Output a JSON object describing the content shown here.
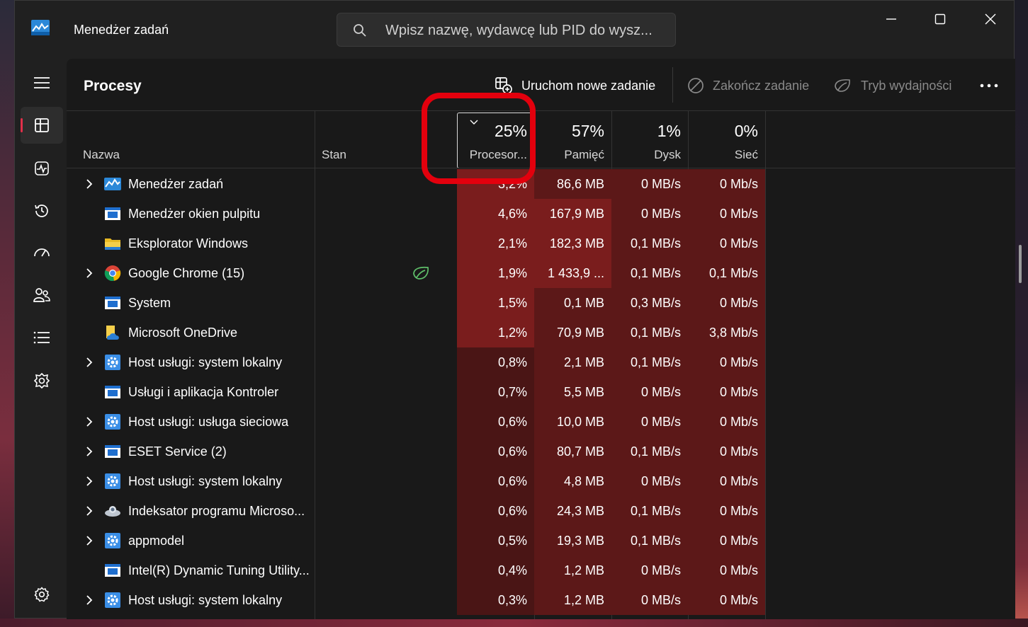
{
  "window": {
    "title": "Menedżer zadań",
    "search_placeholder": "Wpisz nazwę, wydawcę lub PID do wysz..."
  },
  "nav": {
    "items": [
      {
        "icon": "processes-icon",
        "active": true
      },
      {
        "icon": "performance-icon",
        "active": false
      },
      {
        "icon": "app-history-icon",
        "active": false
      },
      {
        "icon": "startup-apps-icon",
        "active": false
      },
      {
        "icon": "users-icon",
        "active": false
      },
      {
        "icon": "details-icon",
        "active": false
      },
      {
        "icon": "services-icon",
        "active": false
      }
    ],
    "settings_icon": "gear-icon"
  },
  "page": {
    "title": "Procesy",
    "commands": {
      "new_task": "Uruchom nowe zadanie",
      "end_task": "Zakończ zadanie",
      "efficiency_mode": "Tryb wydajności"
    }
  },
  "columns": {
    "name": "Nazwa",
    "status": "Stan",
    "cpu": {
      "pct": "25%",
      "label": "Procesor..."
    },
    "memory": {
      "pct": "57%",
      "label": "Pamięć"
    },
    "disk": {
      "pct": "1%",
      "label": "Dysk"
    },
    "network": {
      "pct": "0%",
      "label": "Sieć"
    }
  },
  "colors": {
    "accent": "#e0304a",
    "heat_high": "#7a1d1d",
    "heat_mid": "#5c1818",
    "heat_low": "#4a1515",
    "highlight": "#e3000d"
  },
  "processes": [
    {
      "name": "Menedżer zadań",
      "expandable": true,
      "icon": "taskmanager-icon",
      "cpu": "3,2%",
      "mem": "86,6 MB",
      "disk": "0 MB/s",
      "net": "0 Mb/s",
      "efficiency": false
    },
    {
      "name": "Menedżer okien pulpitu",
      "expandable": false,
      "icon": "window-app-icon",
      "cpu": "4,6%",
      "mem": "167,9 MB",
      "disk": "0 MB/s",
      "net": "0 Mb/s",
      "efficiency": false
    },
    {
      "name": "Eksplorator Windows",
      "expandable": false,
      "icon": "folder-icon",
      "cpu": "2,1%",
      "mem": "182,3 MB",
      "disk": "0,1 MB/s",
      "net": "0 Mb/s",
      "efficiency": false
    },
    {
      "name": "Google Chrome (15)",
      "expandable": true,
      "icon": "chrome-icon",
      "cpu": "1,9%",
      "mem": "1 433,9 ...",
      "disk": "0,1 MB/s",
      "net": "0,1 Mb/s",
      "efficiency": true
    },
    {
      "name": "System",
      "expandable": false,
      "icon": "window-app-icon",
      "cpu": "1,5%",
      "mem": "0,1 MB",
      "disk": "0,3 MB/s",
      "net": "0 Mb/s",
      "efficiency": false
    },
    {
      "name": "Microsoft OneDrive",
      "expandable": false,
      "icon": "onedrive-icon",
      "cpu": "1,2%",
      "mem": "70,9 MB",
      "disk": "0,1 MB/s",
      "net": "3,8 Mb/s",
      "efficiency": false
    },
    {
      "name": "Host usługi: system lokalny",
      "expandable": true,
      "icon": "service-gear-icon",
      "cpu": "0,8%",
      "mem": "2,1 MB",
      "disk": "0,1 MB/s",
      "net": "0 Mb/s",
      "efficiency": false
    },
    {
      "name": "Usługi i aplikacja Kontroler",
      "expandable": false,
      "icon": "window-app-icon",
      "cpu": "0,7%",
      "mem": "5,5 MB",
      "disk": "0 MB/s",
      "net": "0 Mb/s",
      "efficiency": false
    },
    {
      "name": "Host usługi: usługa sieciowa",
      "expandable": true,
      "icon": "service-gear-icon",
      "cpu": "0,6%",
      "mem": "10,0 MB",
      "disk": "0 MB/s",
      "net": "0 Mb/s",
      "efficiency": false
    },
    {
      "name": "ESET Service (2)",
      "expandable": true,
      "icon": "window-app-icon",
      "cpu": "0,6%",
      "mem": "80,7 MB",
      "disk": "0,1 MB/s",
      "net": "0 Mb/s",
      "efficiency": false
    },
    {
      "name": "Host usługi: system lokalny",
      "expandable": true,
      "icon": "service-gear-icon",
      "cpu": "0,6%",
      "mem": "4,8 MB",
      "disk": "0 MB/s",
      "net": "0 Mb/s",
      "efficiency": false
    },
    {
      "name": "Indeksator programu Microso...",
      "expandable": true,
      "icon": "indexer-icon",
      "cpu": "0,6%",
      "mem": "24,3 MB",
      "disk": "0,1 MB/s",
      "net": "0 Mb/s",
      "efficiency": false
    },
    {
      "name": "appmodel",
      "expandable": true,
      "icon": "service-gear-icon",
      "cpu": "0,5%",
      "mem": "19,3 MB",
      "disk": "0,1 MB/s",
      "net": "0 Mb/s",
      "efficiency": false
    },
    {
      "name": "Intel(R) Dynamic Tuning Utility...",
      "expandable": false,
      "icon": "window-app-icon",
      "cpu": "0,4%",
      "mem": "1,2 MB",
      "disk": "0 MB/s",
      "net": "0 Mb/s",
      "efficiency": false
    },
    {
      "name": "Host usługi: system lokalny",
      "expandable": true,
      "icon": "service-gear-icon",
      "cpu": "0,3%",
      "mem": "1,2 MB",
      "disk": "0 MB/s",
      "net": "0 Mb/s",
      "efficiency": false
    }
  ]
}
